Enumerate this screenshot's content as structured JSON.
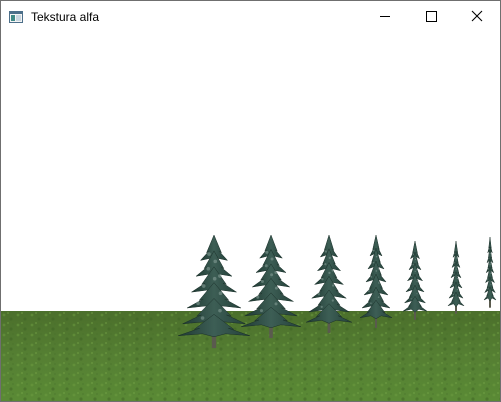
{
  "window": {
    "title": "Tekstura alfa"
  },
  "icons": {
    "app": "application-window-icon",
    "minimize": "minimize-icon",
    "maximize": "maximize-icon",
    "close": "close-icon",
    "tree": "pine-tree-icon"
  },
  "scene": {
    "sky_color": "#ffffff",
    "ground_color": "#4f7a2e",
    "tree_count": 7
  }
}
